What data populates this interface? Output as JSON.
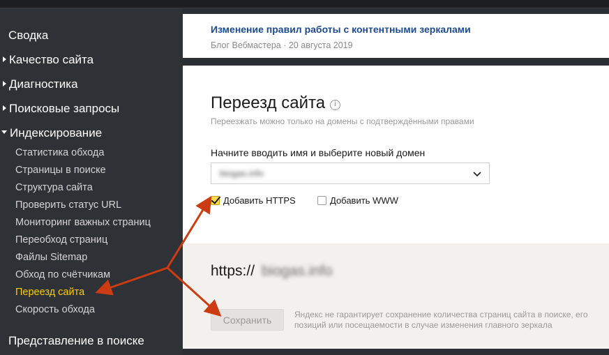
{
  "sidebar": {
    "summary": "Сводка",
    "quality": "Качество сайта",
    "diagnostics": "Диагностика",
    "queries": "Поисковые запросы",
    "indexing": "Индексирование",
    "indexing_items": [
      "Статистика обхода",
      "Страницы в поиске",
      "Структура сайта",
      "Проверить статус URL",
      "Мониторинг важных страниц",
      "Переобход страниц",
      "Файлы Sitemap",
      "Обход по счётчикам",
      "Переезд сайта",
      "Скорость обхода"
    ],
    "active_item": "Переезд сайта",
    "search_view": "Представление в поиске"
  },
  "news": {
    "title": "Изменение правил работы с контентными зеркалами",
    "meta": "Блог Вебмастера · 20 августа 2019"
  },
  "move": {
    "title": "Переезд сайта",
    "info_icon": "i",
    "subtitle": "Переезжать можно только на домены с подтверждёнными правами",
    "field_label": "Начните вводить имя и выберите новый домен",
    "domain_value": "biogas.info",
    "https_label": "Добавить HTTPS",
    "https_checked": true,
    "www_label": "Добавить WWW",
    "www_checked": false
  },
  "preview": {
    "protocol": "https://",
    "domain": "biogas.info",
    "save_label": "Сохранить",
    "note": "Яндекс не гарантирует сохранение количества страниц сайта в поиске, его позиций или посещаемости в случае изменения главного зеркала"
  },
  "colors": {
    "sidebar_bg": "#2e3136",
    "active": "#ffcc00",
    "link": "#1b4a8f",
    "arrow": "#cc3b12",
    "checkbox_checked": "#ffdb4d"
  }
}
